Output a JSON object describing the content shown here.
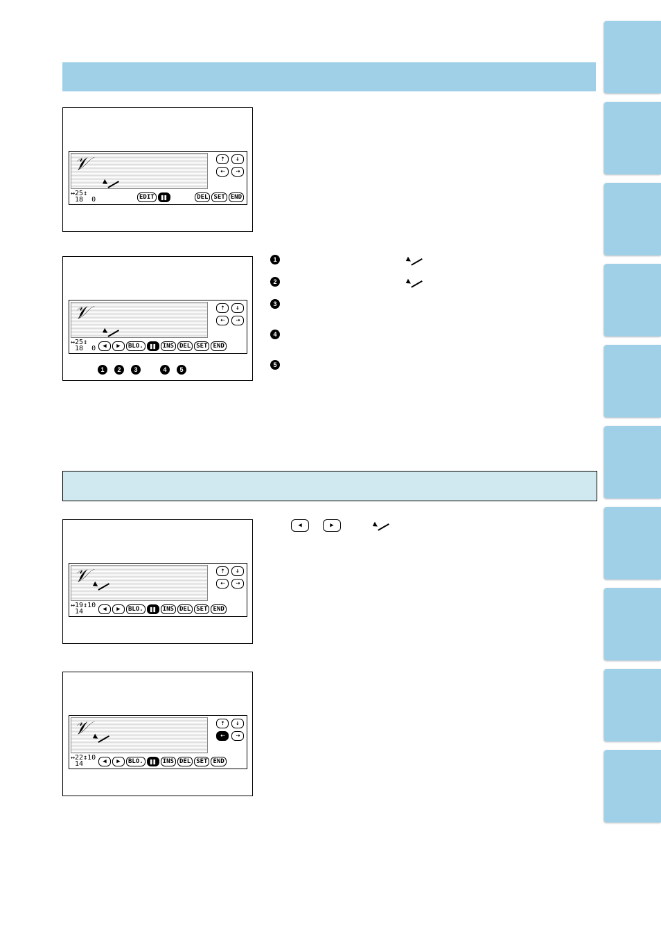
{
  "header1_title": "",
  "header2_title": "",
  "screens": {
    "s1": {
      "x_coord": "25",
      "y_coord": "18",
      "n": "0"
    },
    "s2": {
      "x_coord": "25",
      "y_coord": "18",
      "n": "0"
    },
    "s3": {
      "x_coord": "19",
      "y_coord": "14",
      "n": "10"
    },
    "s4": {
      "x_coord": "22",
      "y_coord": "14",
      "n": "10"
    }
  },
  "buttons": {
    "edit": "EDIT",
    "del": "DEL",
    "set": "SET",
    "end": "END",
    "blo": "BLO.",
    "ins": "INS"
  },
  "legend": {
    "l1": "",
    "l2": "",
    "l3": "",
    "l4": "",
    "l5": ""
  },
  "step_text_1": "",
  "step_text_2": ""
}
